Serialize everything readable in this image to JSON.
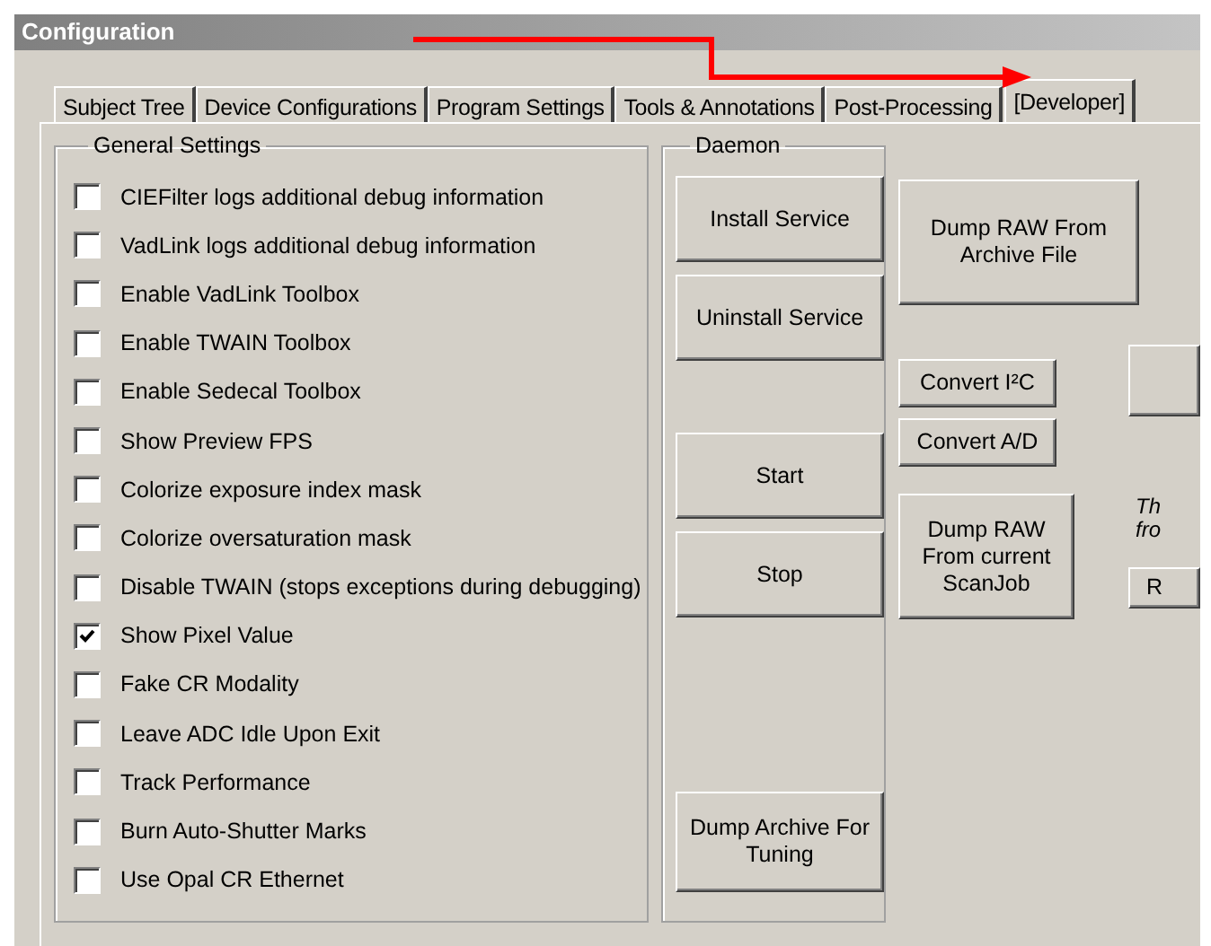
{
  "window": {
    "title": "Configuration"
  },
  "tabs": [
    {
      "label": "Subject Tree",
      "selected": false
    },
    {
      "label": "Device Configurations",
      "selected": false
    },
    {
      "label": "Program Settings",
      "selected": false
    },
    {
      "label": "Tools & Annotations",
      "selected": false
    },
    {
      "label": "Post-Processing",
      "selected": false
    },
    {
      "label": "[Developer]",
      "selected": true
    }
  ],
  "general_settings": {
    "title": "General Settings",
    "options": [
      {
        "label": "CIEFilter logs additional debug information",
        "checked": false
      },
      {
        "label": "VadLink logs additional debug information",
        "checked": false
      },
      {
        "label": "Enable VadLink Toolbox",
        "checked": false
      },
      {
        "label": "Enable TWAIN Toolbox",
        "checked": false
      },
      {
        "label": "Enable Sedecal Toolbox",
        "checked": false
      },
      {
        "label": "Show Preview FPS",
        "checked": false
      },
      {
        "label": "Colorize exposure index mask",
        "checked": false
      },
      {
        "label": "Colorize oversaturation mask",
        "checked": false
      },
      {
        "label": "Disable TWAIN (stops exceptions during debugging)",
        "checked": false
      },
      {
        "label": "Show Pixel Value",
        "checked": true
      },
      {
        "label": "Fake CR Modality",
        "checked": false
      },
      {
        "label": "Leave ADC Idle Upon Exit",
        "checked": false
      },
      {
        "label": "Track Performance",
        "checked": false
      },
      {
        "label": "Burn Auto-Shutter Marks",
        "checked": false
      },
      {
        "label": "Use Opal CR Ethernet",
        "checked": false
      }
    ]
  },
  "daemon": {
    "title": "Daemon",
    "service_buttons": [
      "Install Service",
      "Uninstall Service"
    ],
    "run_buttons": [
      "Start",
      "Stop"
    ],
    "tuning_button": "Dump Archive For\nTuning"
  },
  "tools": {
    "archive_button": "Dump RAW From\nArchive File",
    "convert_buttons": [
      "Convert I²C",
      "Convert A/D"
    ],
    "scanjob_button": "Dump RAW\nFrom current\nScanJob"
  },
  "cut_off_column": {
    "note_lines": [
      "Th",
      "fro"
    ],
    "button": "R"
  }
}
